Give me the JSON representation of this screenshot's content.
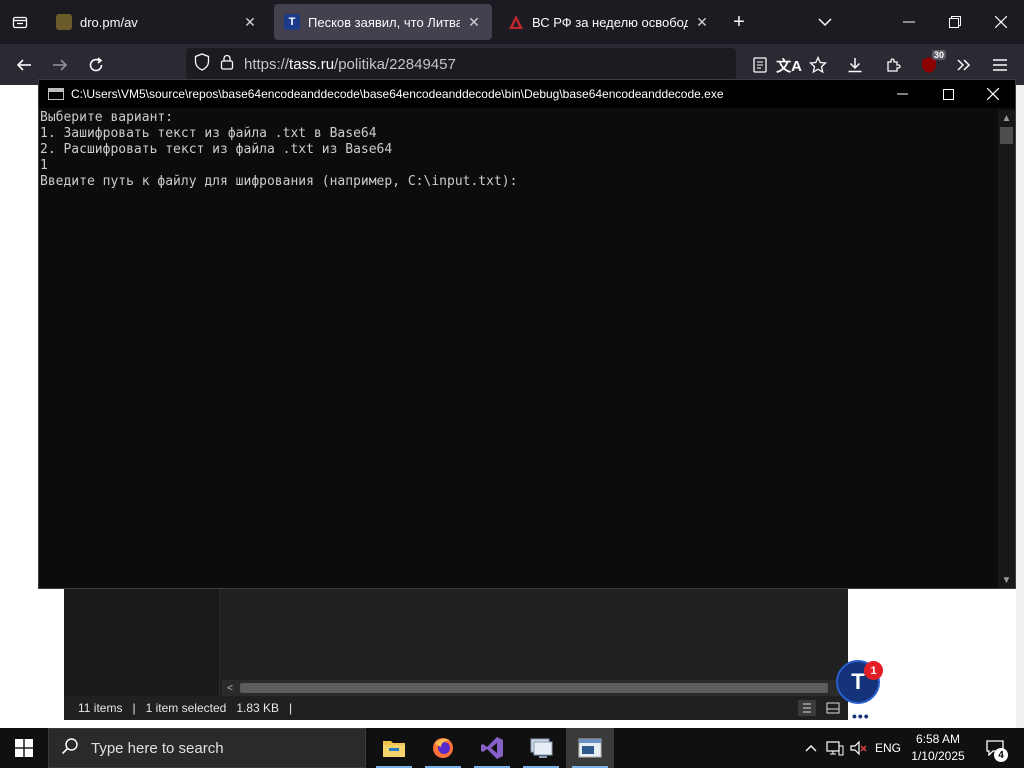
{
  "browser": {
    "tabs": [
      {
        "title": "dro.pm/av",
        "active": false
      },
      {
        "title": "Песков заявил, что Литва име",
        "active": true,
        "favicon_letter": "T"
      },
      {
        "title": "ВС РФ за неделю освободили",
        "active": false
      }
    ],
    "url": {
      "scheme": "https://",
      "host": "tass.ru",
      "path": "/politika/22849457"
    },
    "badge_count": "30"
  },
  "explorer": {
    "items_count": "11 items",
    "selected": "1 item selected",
    "size": "1.83 KB",
    "separator": "|"
  },
  "tass": {
    "logo_letter": "T",
    "notification_count": "1",
    "dots": "•••"
  },
  "console": {
    "title": "C:\\Users\\VM5\\source\\repos\\base64encodeanddecode\\base64encodeanddecode\\bin\\Debug\\base64encodeanddecode.exe",
    "lines": [
      "Выберите вариант:",
      "1. Зашифровать текст из файла .txt в Base64",
      "2. Расшифровать текст из файла .txt из Base64",
      "1",
      "Введите путь к файлу для шифрования (например, C:\\input.txt):"
    ]
  },
  "taskbar": {
    "search_placeholder": "Type here to search",
    "language": "ENG",
    "time": "6:58 AM",
    "date": "1/10/2025",
    "notification_count": "4"
  },
  "colors": {
    "browser_bg": "#1c1b22",
    "console_bg": "#0c0c0c",
    "console_text": "#cccccc",
    "taskbar_bg": "#101010",
    "tass_blue": "#14337a",
    "tass_red": "#e31e24"
  }
}
